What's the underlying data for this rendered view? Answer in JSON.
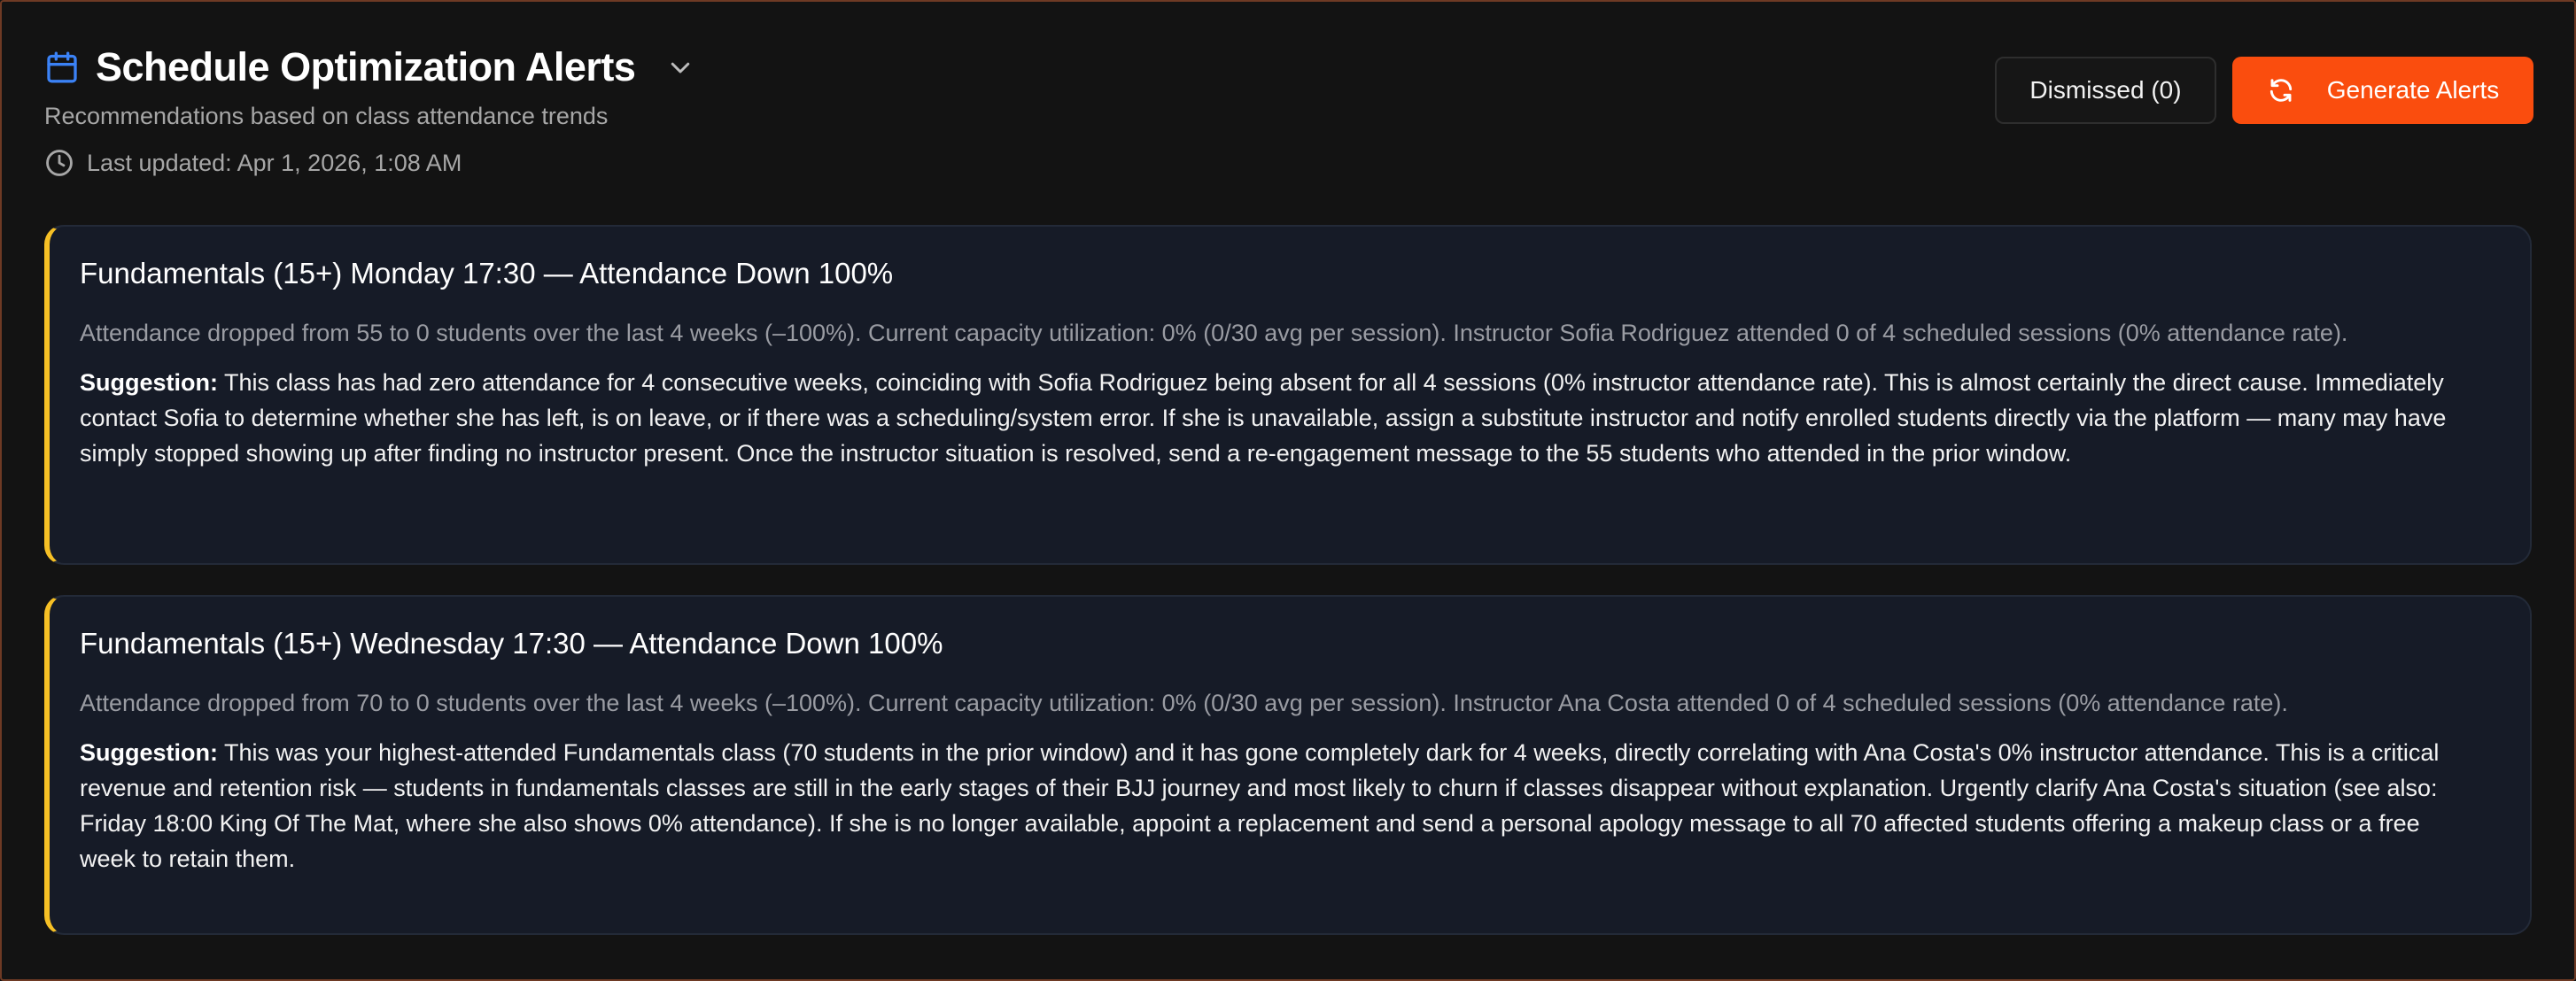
{
  "header": {
    "title": "Schedule Optimization Alerts",
    "subtitle": "Recommendations based on class attendance trends",
    "last_updated": "Last updated: Apr 1, 2026, 1:08 AM",
    "icons": {
      "title": "calendar-icon",
      "toggle": "chevron-down-icon",
      "updated": "clock-icon"
    }
  },
  "actions": {
    "dismissed_label": "Dismissed (0)",
    "generate_label": "Generate Alerts",
    "generate_icon": "refresh-icon"
  },
  "colors": {
    "background": "#131313",
    "card_background": "#161b27",
    "accent_orange": "#fa4d0e",
    "card_stripe_yellow": "#f6c025",
    "title_icon_blue": "#3b82f6"
  },
  "alerts": [
    {
      "title": "Fundamentals (15+) Monday 17:30 — Attendance Down 100%",
      "description": "Attendance dropped from 55 to 0 students over the last 4 weeks (–100%). Current capacity utilization: 0% (0/30 avg per session). Instructor Sofia Rodriguez attended 0 of 4 scheduled sessions (0% attendance rate).",
      "suggestion_label": "Suggestion:",
      "suggestion": "This class has had zero attendance for 4 consecutive weeks, coinciding with Sofia Rodriguez being absent for all 4 sessions (0% instructor attendance rate). This is almost certainly the direct cause. Immediately contact Sofia to determine whether she has left, is on leave, or if there was a scheduling/system error. If she is unavailable, assign a substitute instructor and notify enrolled students directly via the platform — many may have simply stopped showing up after finding no instructor present. Once the instructor situation is resolved, send a re-engagement message to the 55 students who attended in the prior window."
    },
    {
      "title": "Fundamentals (15+) Wednesday 17:30 — Attendance Down 100%",
      "description": "Attendance dropped from 70 to 0 students over the last 4 weeks (–100%). Current capacity utilization: 0% (0/30 avg per session). Instructor Ana Costa attended 0 of 4 scheduled sessions (0% attendance rate).",
      "suggestion_label": "Suggestion:",
      "suggestion": "This was your highest-attended Fundamentals class (70 students in the prior window) and it has gone completely dark for 4 weeks, directly correlating with Ana Costa's 0% instructor attendance. This is a critical revenue and retention risk — students in fundamentals classes are still in the early stages of their BJJ journey and most likely to churn if classes disappear without explanation. Urgently clarify Ana Costa's situation (see also: Friday 18:00 King Of The Mat, where she also shows 0% attendance). If she is no longer available, appoint a replacement and send a personal apology message to all 70 affected students offering a makeup class or a free week to retain them."
    }
  ]
}
